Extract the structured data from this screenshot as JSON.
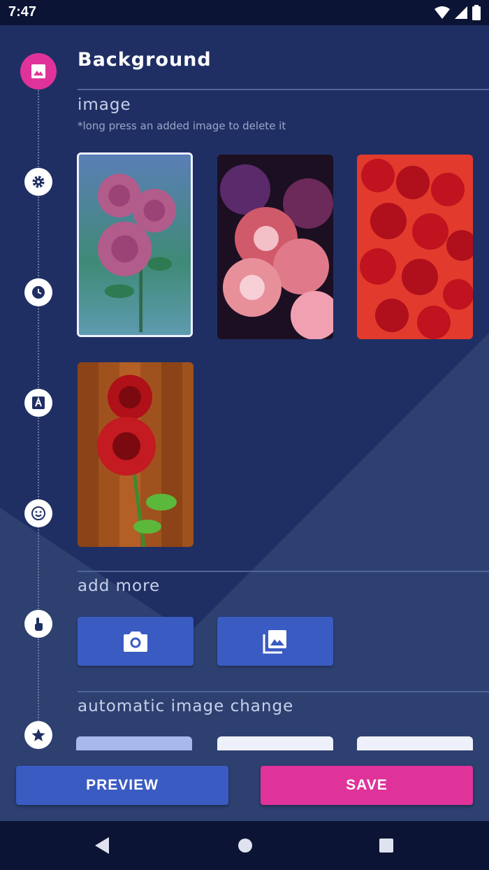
{
  "status_bar": {
    "time": "7:47"
  },
  "header": {
    "title": "Background"
  },
  "image_section": {
    "title": "image",
    "hint": "*long press an added image to delete it",
    "thumbnails": [
      {
        "name": "rose-thumb-1",
        "selected": true
      },
      {
        "name": "rose-thumb-2",
        "selected": false
      },
      {
        "name": "rose-thumb-3",
        "selected": false
      },
      {
        "name": "rose-thumb-4",
        "selected": false
      }
    ]
  },
  "add_more": {
    "title": "add more",
    "buttons": [
      {
        "icon": "camera-icon"
      },
      {
        "icon": "gallery-icon"
      }
    ]
  },
  "auto_change": {
    "title": "automatic image change"
  },
  "timeline": {
    "steps": [
      "image-icon",
      "gear-icon",
      "clock-icon",
      "font-icon",
      "smiley-icon",
      "touch-icon",
      "star-icon"
    ]
  },
  "footer": {
    "preview_label": "PREVIEW",
    "save_label": "SAVE"
  },
  "colors": {
    "background": "#1f2f63",
    "accent_pink": "#e0339a",
    "button_blue": "#3a5bc2",
    "nav_bar": "#0b1434"
  }
}
